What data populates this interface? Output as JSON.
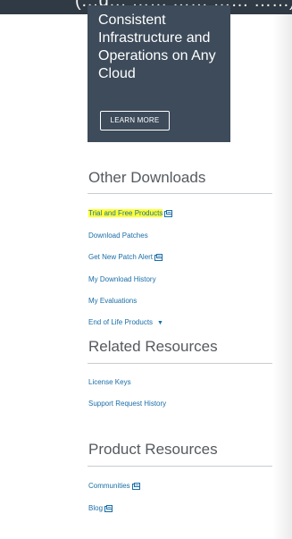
{
  "topbar": {
    "partial_text": "(…g… …… …… …… ……)"
  },
  "promo": {
    "text": "Consistent Infrastructure and Operations on Any Cloud",
    "button_label": "LEARN MORE"
  },
  "other_downloads": {
    "title": "Other Downloads",
    "links": [
      {
        "label": "Trial and Free Products",
        "external": true,
        "highlighted": true
      },
      {
        "label": "Download Patches",
        "external": false
      },
      {
        "label": "Get New Patch Alert",
        "external": true
      },
      {
        "label": "My Download History",
        "external": false
      },
      {
        "label": "My Evaluations",
        "external": false
      },
      {
        "label": "End of Life Products",
        "external": false,
        "dropdown": true
      }
    ]
  },
  "related_resources": {
    "title": "Related Resources",
    "links": [
      {
        "label": "License Keys"
      },
      {
        "label": "Support Request History"
      }
    ]
  },
  "product_resources": {
    "title": "Product Resources",
    "links": [
      {
        "label": "Communities",
        "external": true
      },
      {
        "label": "Blog",
        "external": true
      }
    ]
  },
  "colors": {
    "link": "#1a6ea8",
    "highlight": "#ffff33",
    "promo_bg": "#3d4b5a"
  }
}
